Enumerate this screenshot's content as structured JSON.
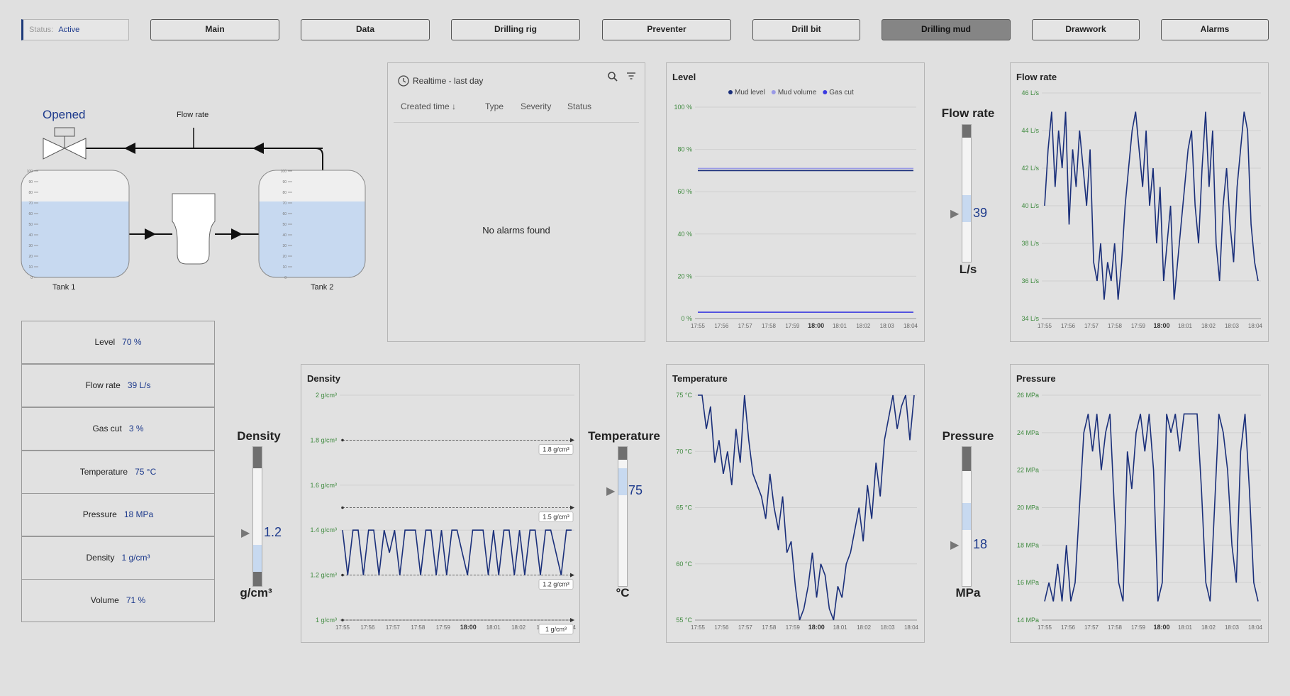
{
  "status": {
    "label": "Status:",
    "value": "Active"
  },
  "nav": [
    "Main",
    "Data",
    "Drilling rig",
    "Preventer",
    "Drill bit",
    "Drilling mud",
    "Drawwork",
    "Alarms"
  ],
  "nav_active": "Drilling mud",
  "diagram": {
    "valve_state": "Opened",
    "flow_label": "Flow rate",
    "tank1": "Tank 1",
    "tank2": "Tank 2",
    "tank_ticks": [
      "100",
      "90",
      "80",
      "70",
      "60",
      "50",
      "40",
      "30",
      "20",
      "10",
      "0"
    ]
  },
  "stats": [
    {
      "label": "Level",
      "value": "70 %"
    },
    {
      "label": "Flow rate",
      "value": "39 L/s"
    },
    {
      "label": "Gas cut",
      "value": "3 %"
    },
    {
      "label": "Temperature",
      "value": "75 °C"
    },
    {
      "label": "Pressure",
      "value": "18 MPa"
    },
    {
      "label": "Density",
      "value": "1 g/cm³"
    },
    {
      "label": "Volume",
      "value": "71 %"
    }
  ],
  "alarms": {
    "title": "Realtime - last day",
    "columns": [
      "Created time",
      "Type",
      "Severity",
      "Status"
    ],
    "empty": "No alarms found"
  },
  "gauges": {
    "flow": {
      "title": "Flow rate",
      "value": "39",
      "unit": "L/s",
      "fraction": 0.39
    },
    "density": {
      "title": "Density",
      "value": "1.2",
      "unit": "g/cm³",
      "fraction": 0.2
    },
    "temperature": {
      "title": "Temperature",
      "value": "75",
      "unit": "°C",
      "fraction": 0.75
    },
    "pressure": {
      "title": "Pressure",
      "value": "18",
      "unit": "MPa",
      "fraction": 0.5
    }
  },
  "colors": {
    "line": "#1a2f7a",
    "accent": "#1d3a8c",
    "grid_label": "#3f8a3f",
    "tank_fill": "#c7d9f0"
  },
  "chart_data": [
    {
      "id": "level",
      "type": "line",
      "title": "Level",
      "x": [
        "17:55",
        "17:56",
        "17:57",
        "17:58",
        "17:59",
        "18:00",
        "18:01",
        "18:02",
        "18:03",
        "18:04"
      ],
      "yticks": [
        "0 %",
        "20 %",
        "40 %",
        "60 %",
        "80 %",
        "100 %"
      ],
      "ylim": [
        0,
        100
      ],
      "legend": [
        "Mud level",
        "Mud volume",
        "Gas cut"
      ],
      "series": [
        {
          "name": "Mud level",
          "values": [
            70,
            70,
            70,
            70,
            70,
            70,
            70,
            70,
            70,
            70
          ],
          "color": "#1a2f7a"
        },
        {
          "name": "Mud volume",
          "values": [
            71,
            71,
            71,
            71,
            71,
            71,
            71,
            71,
            71,
            71
          ],
          "color": "#9a9ae6"
        },
        {
          "name": "Gas cut",
          "values": [
            3,
            3,
            3,
            3,
            3,
            3,
            3,
            3,
            3,
            3
          ],
          "color": "#3a3ae0"
        }
      ]
    },
    {
      "id": "flow",
      "type": "line",
      "title": "Flow rate",
      "x": [
        "17:55",
        "17:56",
        "17:57",
        "17:58",
        "17:59",
        "18:00",
        "18:01",
        "18:02",
        "18:03",
        "18:04"
      ],
      "yticks": [
        "34 L/s",
        "36 L/s",
        "38 L/s",
        "40 L/s",
        "42 L/s",
        "44 L/s",
        "46 L/s"
      ],
      "ylim": [
        34,
        46
      ],
      "series": [
        {
          "values": [
            40,
            43,
            45,
            41,
            44,
            42,
            45,
            39,
            43,
            41,
            44,
            42,
            40,
            43,
            37,
            36,
            38,
            35,
            37,
            36,
            38,
            35,
            37,
            40,
            42,
            44,
            45,
            43,
            41,
            44,
            40,
            42,
            38,
            41,
            36,
            38,
            40,
            35,
            37,
            39,
            41,
            43,
            44,
            40,
            38,
            42,
            45,
            41,
            44,
            38,
            36,
            40,
            42,
            39,
            37,
            41,
            43,
            45,
            44,
            39,
            37,
            36
          ]
        }
      ]
    },
    {
      "id": "density",
      "type": "line",
      "title": "Density",
      "x": [
        "17:55",
        "17:56",
        "17:57",
        "17:58",
        "17:59",
        "18:00",
        "18:01",
        "18:02",
        "18:03",
        "18:04"
      ],
      "yticks": [
        "1 g/cm³",
        "1.2 g/cm³",
        "1.4 g/cm³",
        "1.6 g/cm³",
        "1.8 g/cm³",
        "2 g/cm³"
      ],
      "ylim": [
        1,
        2
      ],
      "thresholds": [
        {
          "value": 1.8,
          "label": "1.8 g/cm³"
        },
        {
          "value": 1.5,
          "label": "1.5 g/cm³"
        },
        {
          "value": 1.2,
          "label": "1.2 g/cm³"
        },
        {
          "value": 1,
          "label": "1 g/cm³"
        }
      ],
      "series": [
        {
          "values": [
            1.4,
            1.2,
            1.4,
            1.4,
            1.2,
            1.4,
            1.4,
            1.2,
            1.4,
            1.3,
            1.4,
            1.2,
            1.4,
            1.4,
            1.4,
            1.2,
            1.4,
            1.4,
            1.2,
            1.4,
            1.2,
            1.4,
            1.4,
            1.3,
            1.2,
            1.4,
            1.4,
            1.4,
            1.2,
            1.4,
            1.2,
            1.4,
            1.4,
            1.2,
            1.4,
            1.2,
            1.4,
            1.4,
            1.2,
            1.4,
            1.4,
            1.3,
            1.2,
            1.4,
            1.4
          ]
        }
      ]
    },
    {
      "id": "temperature",
      "type": "line",
      "title": "Temperature",
      "x": [
        "17:55",
        "17:56",
        "17:57",
        "17:58",
        "17:59",
        "18:00",
        "18:01",
        "18:02",
        "18:03",
        "18:04"
      ],
      "yticks": [
        "55 °C",
        "60 °C",
        "65 °C",
        "70 °C",
        "75 °C"
      ],
      "ylim": [
        55,
        75
      ],
      "series": [
        {
          "values": [
            75,
            75,
            72,
            74,
            69,
            71,
            68,
            70,
            67,
            72,
            69,
            75,
            71,
            68,
            67,
            66,
            64,
            68,
            65,
            63,
            66,
            61,
            62,
            58,
            55,
            56,
            58,
            61,
            57,
            60,
            59,
            56,
            55,
            58,
            57,
            60,
            61,
            63,
            65,
            62,
            67,
            64,
            69,
            66,
            71,
            73,
            75,
            72,
            74,
            75,
            71,
            75
          ]
        }
      ]
    },
    {
      "id": "pressure",
      "type": "line",
      "title": "Pressure",
      "x": [
        "17:55",
        "17:56",
        "17:57",
        "17:58",
        "17:59",
        "18:00",
        "18:01",
        "18:02",
        "18:03",
        "18:04"
      ],
      "yticks": [
        "14 MPa",
        "16 MPa",
        "18 MPa",
        "20 MPa",
        "22 MPa",
        "24 MPa",
        "26 MPa"
      ],
      "ylim": [
        14,
        26
      ],
      "series": [
        {
          "values": [
            15,
            16,
            15,
            17,
            15,
            18,
            15,
            16,
            20,
            24,
            25,
            23,
            25,
            22,
            24,
            25,
            20,
            16,
            15,
            23,
            21,
            24,
            25,
            23,
            25,
            22,
            15,
            16,
            25,
            24,
            25,
            23,
            25,
            25,
            25,
            25,
            21,
            16,
            15,
            20,
            25,
            24,
            22,
            18,
            16,
            23,
            25,
            21,
            16,
            15
          ]
        }
      ]
    }
  ]
}
